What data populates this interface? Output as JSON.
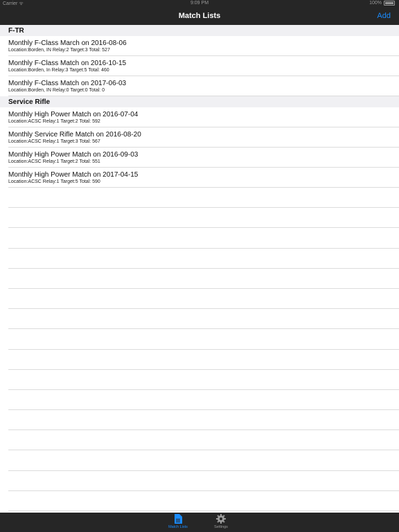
{
  "status": {
    "carrier": "Carrier ᯤ",
    "time": "9:09 PM",
    "battery": "100%"
  },
  "nav": {
    "title": "Match Lists",
    "add_label": "Add"
  },
  "sections": [
    {
      "header": "F-TR",
      "rows": [
        {
          "title": "Monthly F-Class March on 2016-08-06",
          "subtitle": "Location:Borden, IN Relay:2 Target:3 Total: 527"
        },
        {
          "title": "Monthly F-Class Match on 2016-10-15",
          "subtitle": "Location:Borden, In Relay:3 Target:5 Total: 460"
        },
        {
          "title": "Monthly F-Class Match on 2017-06-03",
          "subtitle": "Location:Borden, IN Relay:0 Target:0 Total: 0"
        }
      ]
    },
    {
      "header": "Service Rifle",
      "rows": [
        {
          "title": "Monthly High Power Match on 2016-07-04",
          "subtitle": "Location:ACSC Relay:1 Target:2 Total: 592"
        },
        {
          "title": "Monthly Service Rifle Match on 2016-08-20",
          "subtitle": "Location:ACSC Relay:1 Target:3 Total: 567"
        },
        {
          "title": "Monthly High Power Match on 2016-09-03",
          "subtitle": "Location:ACSC Relay:1 Target:2 Total: 551"
        },
        {
          "title": "Monthly High Power Match on 2017-04-15",
          "subtitle": "Location:ACSC Relay:1 Target:5 Total: 590"
        }
      ]
    }
  ],
  "tabs": [
    {
      "label": "Match Lists",
      "icon": "document-icon",
      "selected": true,
      "color": "#1a8cff"
    },
    {
      "label": "Settings",
      "icon": "gear-icon",
      "selected": false,
      "color": "#9a9a9a"
    }
  ]
}
